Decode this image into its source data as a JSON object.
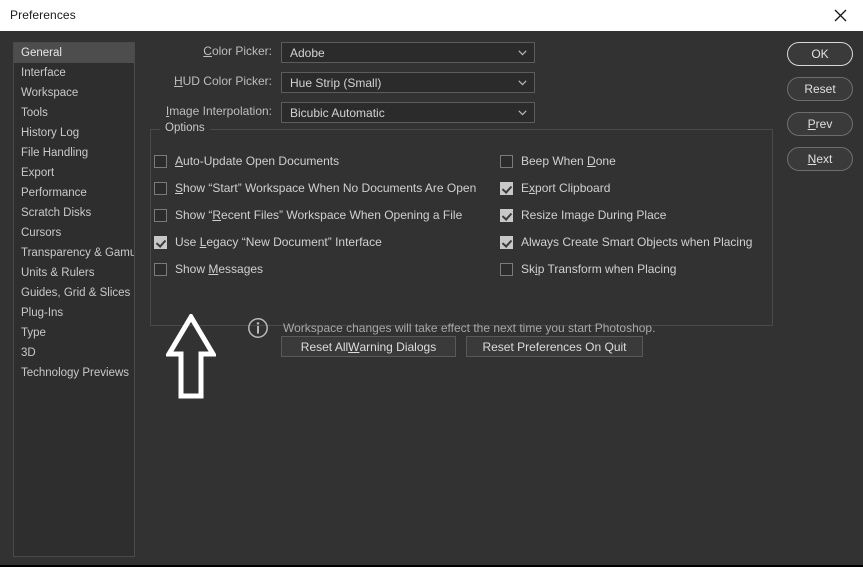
{
  "window": {
    "title": "Preferences",
    "close_icon": "close-icon"
  },
  "sidebar": {
    "items": [
      {
        "label": "General",
        "selected": true
      },
      {
        "label": "Interface",
        "selected": false
      },
      {
        "label": "Workspace",
        "selected": false
      },
      {
        "label": "Tools",
        "selected": false
      },
      {
        "label": "History Log",
        "selected": false
      },
      {
        "label": "File Handling",
        "selected": false
      },
      {
        "label": "Export",
        "selected": false
      },
      {
        "label": "Performance",
        "selected": false
      },
      {
        "label": "Scratch Disks",
        "selected": false
      },
      {
        "label": "Cursors",
        "selected": false
      },
      {
        "label": "Transparency & Gamut",
        "selected": false
      },
      {
        "label": "Units & Rulers",
        "selected": false
      },
      {
        "label": "Guides, Grid & Slices",
        "selected": false
      },
      {
        "label": "Plug-Ins",
        "selected": false
      },
      {
        "label": "Type",
        "selected": false
      },
      {
        "label": "3D",
        "selected": false
      },
      {
        "label": "Technology Previews",
        "selected": false
      }
    ]
  },
  "form": {
    "rows": [
      {
        "label": "Color Picker:",
        "accel": "C",
        "value": "Adobe"
      },
      {
        "label": "HUD Color Picker:",
        "accel": "H",
        "value": "Hue Strip (Small)"
      },
      {
        "label": "Image Interpolation:",
        "accel": "I",
        "value": "Bicubic Automatic"
      }
    ]
  },
  "options": {
    "legend": "Options",
    "left_column": [
      {
        "label": "Auto-Update Open Documents",
        "accel": "A",
        "checked": false
      },
      {
        "label": "Show “Start” Workspace When No Documents Are Open",
        "accel": "S",
        "checked": false
      },
      {
        "label": "Show “Recent Files” Workspace When Opening a File",
        "accel": "R",
        "checked": false
      },
      {
        "label": "Use Legacy “New Document” Interface",
        "accel": "L",
        "checked": true
      },
      {
        "label": "Show Messages",
        "accel": "M",
        "checked": false
      }
    ],
    "right_column": [
      {
        "label": "Beep When Done",
        "accel": "D",
        "checked": false
      },
      {
        "label": "Export Clipboard",
        "accel": "x",
        "checked": true
      },
      {
        "label": "Resize Image During Place",
        "accel": "g",
        "checked": true
      },
      {
        "label": "Always Create Smart Objects when Placing",
        "accel": "j",
        "checked": true
      },
      {
        "label": "Skip Transform when Placing",
        "accel": "i",
        "checked": false
      }
    ],
    "info": {
      "icon": "info-icon",
      "text": "Workspace changes will take effect the next time you start Photoshop."
    }
  },
  "reset_buttons": [
    {
      "label": "Reset All Warning Dialogs",
      "accel": "W"
    },
    {
      "label": "Reset Preferences On Quit",
      "accel": ""
    }
  ],
  "action_buttons": [
    {
      "label": "OK",
      "accel": "",
      "primary": true
    },
    {
      "label": "Reset",
      "accel": "",
      "primary": false
    },
    {
      "label": "Prev",
      "accel": "P",
      "primary": false
    },
    {
      "label": "Next",
      "accel": "N",
      "primary": false
    }
  ],
  "annotation": {
    "shape": "up-arrow",
    "color": "#ffffff"
  }
}
